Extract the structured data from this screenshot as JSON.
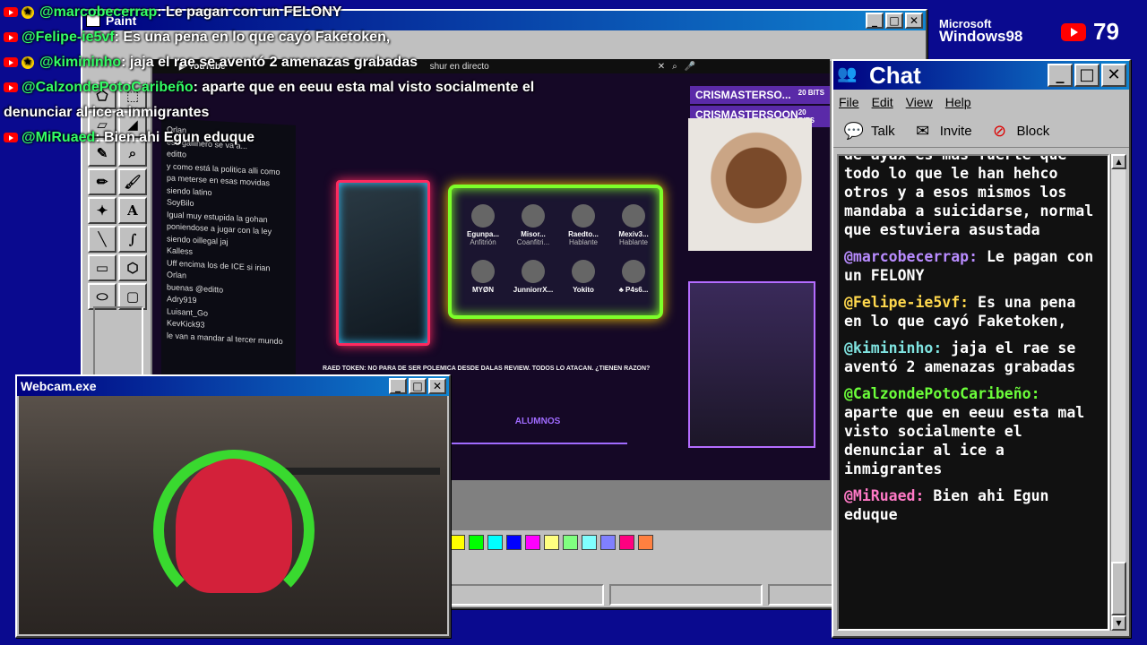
{
  "paint": {
    "title": "Paint"
  },
  "webcam": {
    "title": "Webcam.exe"
  },
  "chat_window": {
    "title": "Chat",
    "menu": [
      "File",
      "Edit",
      "View",
      "Help"
    ],
    "toolbar": [
      {
        "label": "Talk",
        "icon": "talk-icon"
      },
      {
        "label": "Invite",
        "icon": "invite-icon"
      },
      {
        "label": "Block",
        "icon": "block-icon"
      }
    ],
    "messages": [
      {
        "user": "",
        "text": "de ayax es mas fuerte que todo lo que le han hehco otros y a esos mismos los mandaba a suicidarse, normal que estuviera asustada",
        "color": "#ffffff"
      },
      {
        "user": "@marcobecerrap:",
        "text": "Le pagan con un FELONY",
        "color": "#b98cff"
      },
      {
        "user": "@Felipe-ie5vf:",
        "text": "Es una pena en lo que cayó Faketoken,",
        "color": "#ffd84d"
      },
      {
        "user": "@kimininho:",
        "text": "jaja el rae se aventó 2 amenazas grabadas",
        "color": "#7fe3e0"
      },
      {
        "user": "@CalzondePotoCaribeño:",
        "text": "aparte que en eeuu esta mal visto socialmente el denunciar al ice a inmigrantes",
        "color": "#6cff3a"
      },
      {
        "user": "@MiRuaed:",
        "text": "Bien ahi Egun eduque",
        "color": "#ff79c6"
      }
    ]
  },
  "overlay_chat": [
    {
      "user": "@marcobecerrap",
      "text": ": Le pagan con un FELONY",
      "star": true
    },
    {
      "user": "@Felipe-ie5vf",
      "text": ": Es una pena en lo que cayó Faketoken,",
      "star": false
    },
    {
      "user": "@kimininho",
      "text": ": jaja el rae se aventó 2 amenazas grabadas",
      "star": true
    },
    {
      "user": "@CalzondePotoCaribeño",
      "text": ": aparte que en eeuu esta mal visto socialmente el",
      "star": false
    },
    {
      "user": "",
      "text": "denunciar al ice a inmigrantes",
      "star": false
    },
    {
      "user": "@MiRuaed",
      "text": ": Bien ahi Egun eduque",
      "star": false
    }
  ],
  "top_right": {
    "os_brand_1": "Microsoft",
    "os_brand_2": "Windows98",
    "viewer_count": "79"
  },
  "stream": {
    "yt_search": "shur en directo",
    "channel_top": "CRISMASTERSO...",
    "channel_top_bits": "20 BITS",
    "channel_2": "CRISMASTERSOON",
    "channel_2_bits": "20 BITS",
    "video_title": "RAED TOKEN: NO PARA DE SER POLEMICA DESDE DALAS REVIEW. TODOS LO ATACAN. ¿TIENEN RAZON?",
    "alumnos": "ALUMNOS",
    "guests": [
      {
        "name": "Egunpa...",
        "role": "Anfitrión"
      },
      {
        "name": "Misor...",
        "role": "Coanfitri..."
      },
      {
        "name": "Raedto...",
        "role": "Hablante"
      },
      {
        "name": "Mexiv3...",
        "role": "Hablante"
      },
      {
        "name": "MYØN",
        "role": ""
      },
      {
        "name": "JunniorrX...",
        "role": ""
      },
      {
        "name": "Yokito",
        "role": ""
      },
      {
        "name": "♣ P4s6...",
        "role": ""
      }
    ],
    "side_chat": [
      "Orlan",
      "ese gallinero se va a...",
      "editto",
      "y como está la politica alli como pa meterse en esas movidas siendo latino",
      "SoyBilo",
      "Igual muy estupida la gohan poniendose a jugar con la ley siendo oillegal jaj",
      "Kalless",
      "Uff encima los de ICE si irian",
      "Orlan",
      "buenas @editto",
      "Adry919",
      "Luisant_Go",
      "KevKick93",
      "le van a mandar al tercer mundo"
    ]
  },
  "palette_colors": [
    "#ffff00",
    "#00ff00",
    "#00ffff",
    "#0000ff",
    "#ff00ff",
    "#ffff80",
    "#80ff80",
    "#80ffff",
    "#8080ff",
    "#ff0080",
    "#ff8040"
  ]
}
